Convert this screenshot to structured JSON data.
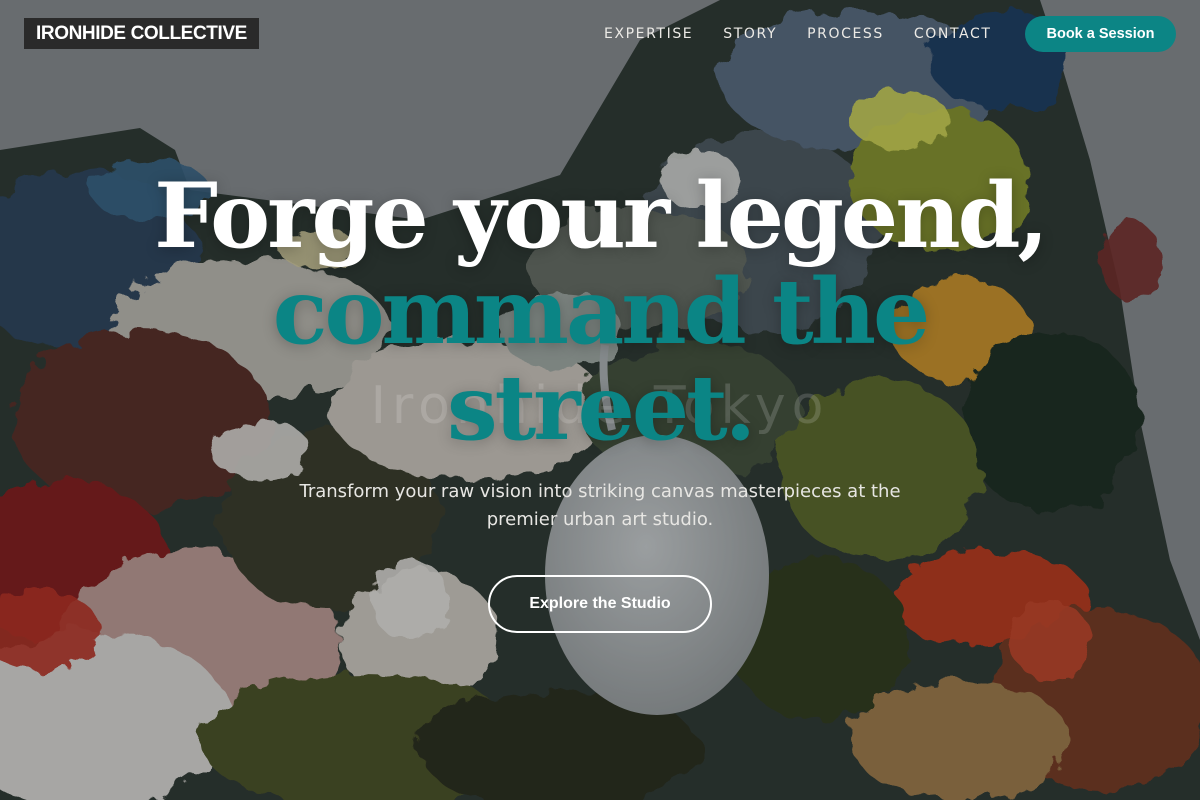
{
  "brand": {
    "name": "IRONHIDE COLLECTIVE"
  },
  "nav": {
    "links": [
      {
        "label": "EXPERTISE"
      },
      {
        "label": "STORY"
      },
      {
        "label": "PROCESS"
      },
      {
        "label": "CONTACT"
      }
    ],
    "cta_label": "Book a Session"
  },
  "hero": {
    "headline_line1": "Forge your legend,",
    "headline_line2": "command the",
    "headline_line3": "street.",
    "background_watermark": "Ironhide Tokyo",
    "subtitle": "Transform your raw vision into striking canvas masterpieces at the premier urban art studio.",
    "button_label": "Explore the Studio"
  },
  "colors": {
    "accent": "#0b8585",
    "logo_background": "#2a2a2a",
    "text_light": "#ffffff"
  },
  "icons": {
    "background_image": "paint-palette-image"
  }
}
